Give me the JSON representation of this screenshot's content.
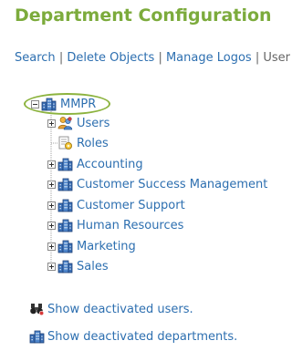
{
  "page": {
    "title": "Department Configuration"
  },
  "actions": {
    "search": "Search",
    "delete_objects": "Delete Objects",
    "manage_logos": "Manage Logos",
    "users_cut": "User",
    "separator": "|"
  },
  "tree": {
    "root": {
      "label": "MMPR",
      "icon": "department-icon",
      "expanded": true
    },
    "children": [
      {
        "label": "Users",
        "icon": "users-icon",
        "expandable": true
      },
      {
        "label": "Roles",
        "icon": "roles-icon",
        "expandable": false
      },
      {
        "label": "Accounting",
        "icon": "department-icon",
        "expandable": true
      },
      {
        "label": "Customer Success Management",
        "icon": "department-icon",
        "expandable": true
      },
      {
        "label": "Customer Support",
        "icon": "department-icon",
        "expandable": true
      },
      {
        "label": "Human Resources",
        "icon": "department-icon",
        "expandable": true
      },
      {
        "label": "Marketing",
        "icon": "department-icon",
        "expandable": true
      },
      {
        "label": "Sales",
        "icon": "department-icon",
        "expandable": true
      }
    ]
  },
  "footer": {
    "show_deactivated_users": "Show deactivated users.",
    "show_deactivated_departments": "Show deactivated departments."
  },
  "colors": {
    "title_green": "#7cab3c",
    "link_blue": "#2d6fb0",
    "highlight_oval": "#8cb33e"
  }
}
